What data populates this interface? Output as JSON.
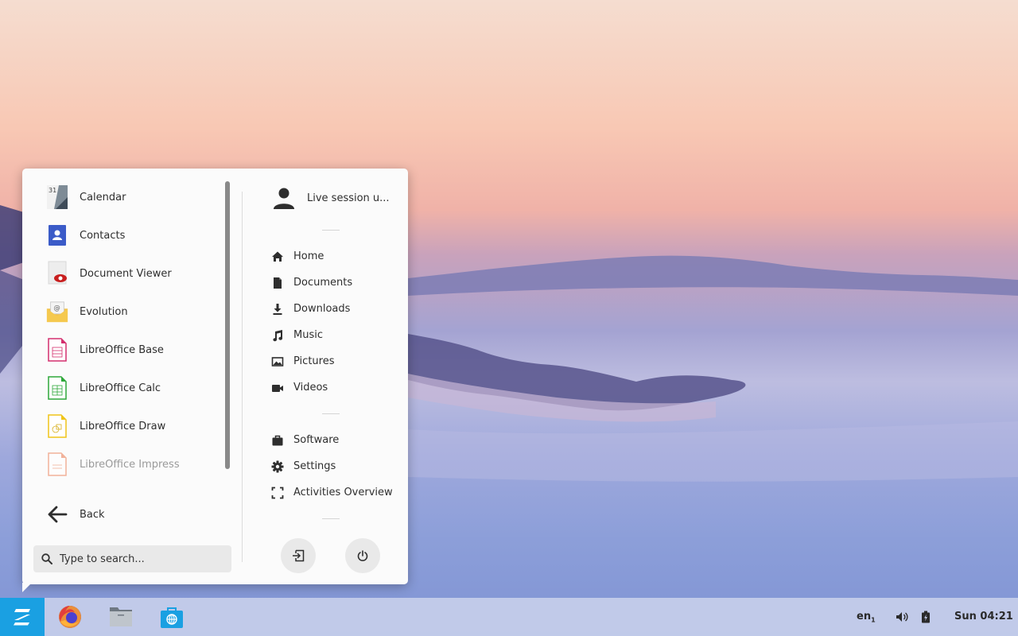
{
  "apps": [
    {
      "label": "Calendar",
      "icon": "calendar-icon",
      "name": "app-calendar",
      "faded": false
    },
    {
      "label": "Contacts",
      "icon": "contacts-icon",
      "name": "app-contacts",
      "faded": false
    },
    {
      "label": "Document Viewer",
      "icon": "document-viewer-icon",
      "name": "app-document-viewer",
      "faded": false
    },
    {
      "label": "Evolution",
      "icon": "evolution-mail-icon",
      "name": "app-evolution",
      "faded": false
    },
    {
      "label": "LibreOffice Base",
      "icon": "libreoffice-base-icon",
      "name": "app-libreoffice-base",
      "faded": false
    },
    {
      "label": "LibreOffice Calc",
      "icon": "libreoffice-calc-icon",
      "name": "app-libreoffice-calc",
      "faded": false
    },
    {
      "label": "LibreOffice Draw",
      "icon": "libreoffice-draw-icon",
      "name": "app-libreoffice-draw",
      "faded": false
    },
    {
      "label": "LibreOffice Impress",
      "icon": "libreoffice-impress-icon",
      "name": "app-libreoffice-impress",
      "faded": true
    }
  ],
  "calendar_day": "31",
  "back_label": "Back",
  "search": {
    "placeholder": "Type to search..."
  },
  "user": {
    "label": "Live session u..."
  },
  "places": [
    {
      "label": "Home",
      "icon": "home-icon",
      "name": "place-home"
    },
    {
      "label": "Documents",
      "icon": "document-icon",
      "name": "place-documents"
    },
    {
      "label": "Downloads",
      "icon": "download-icon",
      "name": "place-downloads"
    },
    {
      "label": "Music",
      "icon": "music-note-icon",
      "name": "place-music"
    },
    {
      "label": "Pictures",
      "icon": "image-icon",
      "name": "place-pictures"
    },
    {
      "label": "Videos",
      "icon": "video-camera-icon",
      "name": "place-videos"
    }
  ],
  "system": [
    {
      "label": "Software",
      "icon": "briefcase-icon",
      "name": "system-software"
    },
    {
      "label": "Settings",
      "icon": "gear-icon",
      "name": "system-settings"
    },
    {
      "label": "Activities Overview",
      "icon": "fullscreen-corners-icon",
      "name": "system-activities-overview"
    }
  ],
  "taskbar": {
    "keyboard_layout": "en",
    "keyboard_layout_sub": "1",
    "clock": "Sun 04:21",
    "pinned": [
      "firefox-icon",
      "file-manager-icon",
      "software-store-icon"
    ]
  },
  "colors": {
    "accent": "#1aa0e2",
    "menu_bg": "#fbfbfb",
    "text": "#2e2e2e"
  }
}
